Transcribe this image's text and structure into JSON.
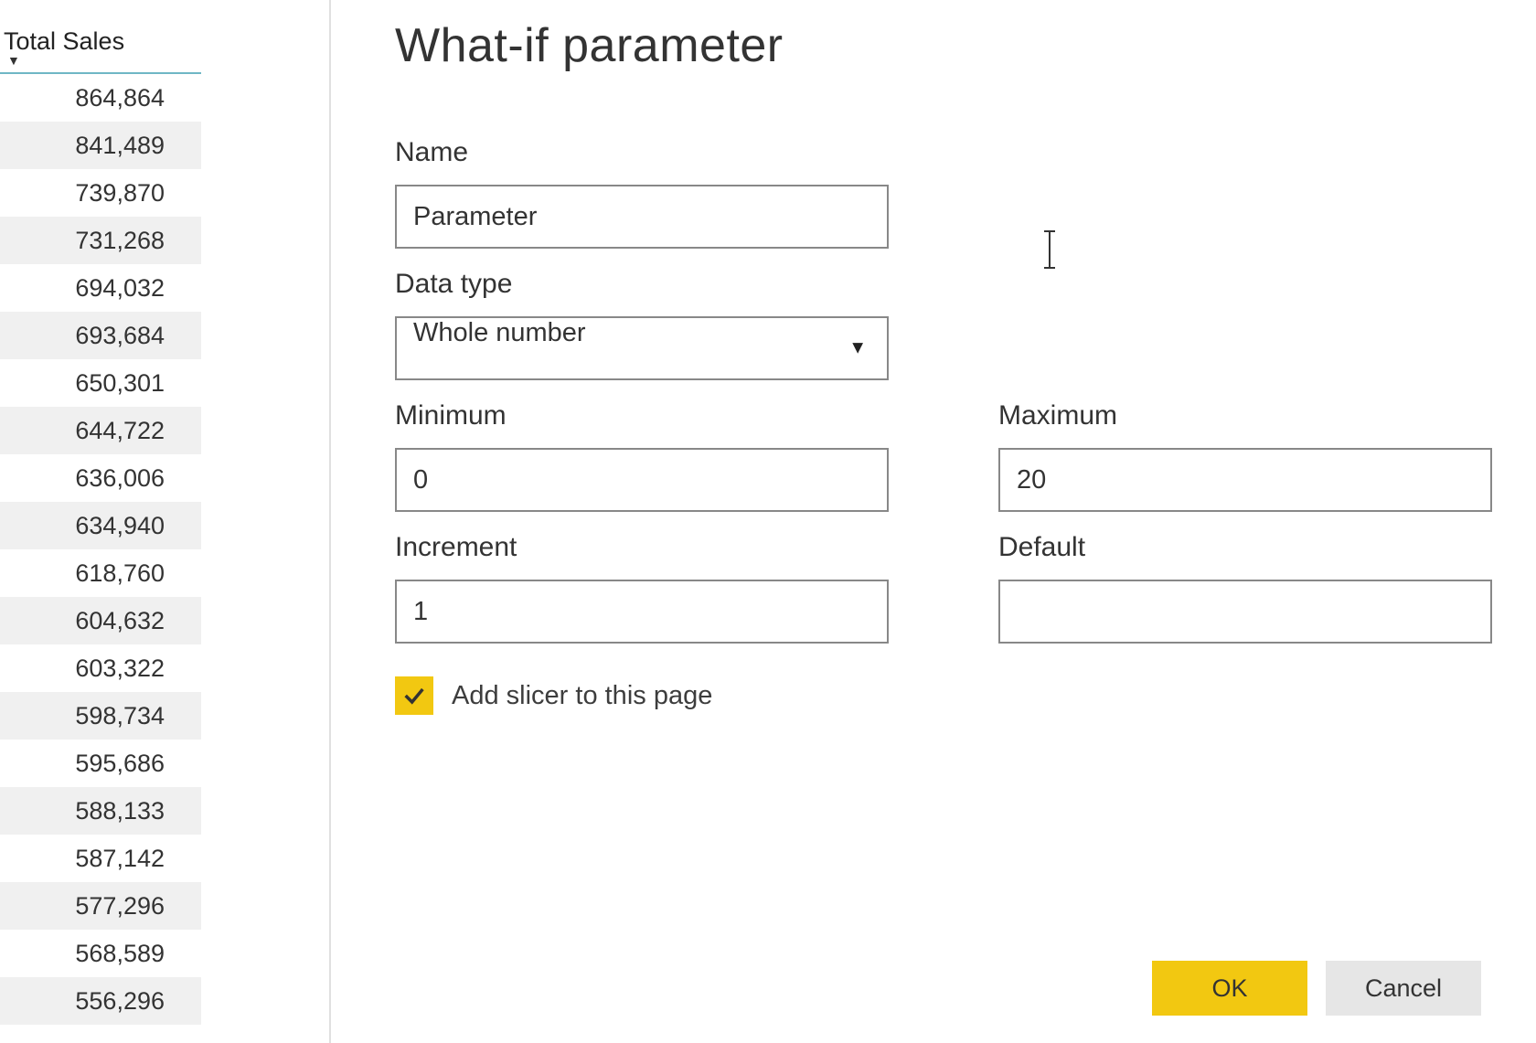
{
  "table": {
    "header": "Total Sales",
    "rows": [
      "864,864",
      "841,489",
      "739,870",
      "731,268",
      "694,032",
      "693,684",
      "650,301",
      "644,722",
      "636,006",
      "634,940",
      "618,760",
      "604,632",
      "603,322",
      "598,734",
      "595,686",
      "588,133",
      "587,142",
      "577,296",
      "568,589",
      "556,296"
    ]
  },
  "dialog": {
    "title": "What-if parameter",
    "fields": {
      "name_label": "Name",
      "name_value": "Parameter",
      "datatype_label": "Data type",
      "datatype_value": "Whole number",
      "min_label": "Minimum",
      "min_value": "0",
      "max_label": "Maximum",
      "max_value": "20",
      "increment_label": "Increment",
      "increment_value": "1",
      "default_label": "Default",
      "default_value": ""
    },
    "checkbox_label": "Add slicer to this page",
    "checkbox_checked": true,
    "ok_label": "OK",
    "cancel_label": "Cancel"
  },
  "colors": {
    "accent": "#f2c811",
    "header_border": "#6fb7c5"
  }
}
